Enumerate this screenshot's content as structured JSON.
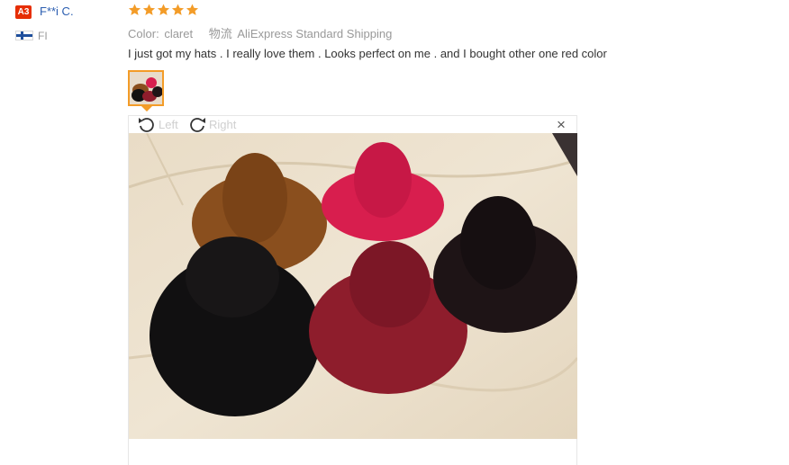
{
  "reviewer": {
    "badge": "A3",
    "name": "F**i C.",
    "country": "FI"
  },
  "review": {
    "rating": 5,
    "rating_max": 5,
    "star_color": "#f39c28",
    "color_label": "Color:",
    "color_value": "claret",
    "shipping_label": "物流",
    "shipping_value": "AliExpress Standard Shipping",
    "text": "I just got my hats . I really love them . Looks perfect on me . and I bought other one red color"
  },
  "viewer": {
    "rotate_left_label": "Left",
    "rotate_right_label": "Right",
    "close_symbol": "×"
  },
  "colors": {
    "accent": "#f39c28",
    "badge": "#e62e04",
    "link": "#2a5db0"
  }
}
